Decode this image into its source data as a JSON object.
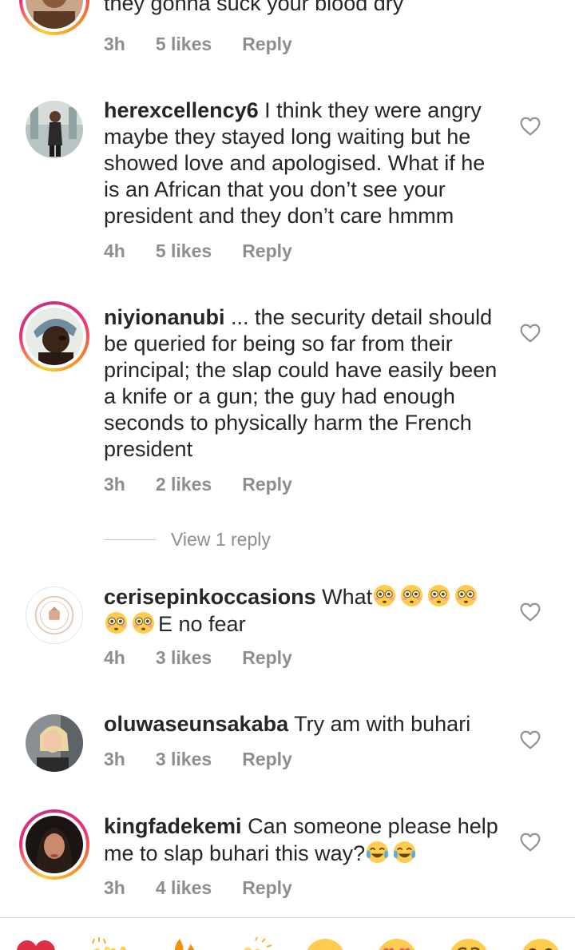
{
  "comments": [
    {
      "username": "",
      "text": "they gonna suck your blood dry",
      "time": "3h",
      "likes": "5 likes",
      "reply": "Reply",
      "story_ring": true
    },
    {
      "username": "herexcellency6",
      "text": "I think they were angry maybe they stayed long waiting but he showed love and apologised. What if he is an African that you don’t see your president and they don’t care hmmm",
      "time": "4h",
      "likes": "5 likes",
      "reply": "Reply",
      "story_ring": false
    },
    {
      "username": "niyionanubi",
      "text": "... the security detail should be queried for being so far from their principal; the slap could have easily been a knife or a gun; the guy had enough seconds to physically harm the French president",
      "time": "3h",
      "likes": "2 likes",
      "reply": "Reply",
      "story_ring": true,
      "view_replies": "View 1 reply"
    },
    {
      "username": "cerisepinkoccasions",
      "text_before": "What",
      "text_after": "E no fear",
      "emoji": "flushed-face",
      "time": "4h",
      "likes": "3 likes",
      "reply": "Reply",
      "story_ring": false
    },
    {
      "username": "oluwaseunsakaba",
      "text": "Try am with buhari",
      "time": "3h",
      "likes": "3 likes",
      "reply": "Reply",
      "story_ring": false
    },
    {
      "username": "kingfadekemi",
      "text": "Can someone please help me to slap buhari this way?",
      "emoji": "tears-of-joy",
      "time": "3h",
      "likes": "4 likes",
      "reply": "Reply",
      "story_ring": true
    }
  ],
  "reactions": [
    "red-heart",
    "raising-hands",
    "fire",
    "clapping-hands",
    "crying-face",
    "heart-eyes",
    "astonished-face",
    "tears-of-joy"
  ],
  "colors": {
    "text": "#262626",
    "meta": "#8e8e8e",
    "heart_outline": "#8e8e8e",
    "divider": "#dbdbdb"
  }
}
